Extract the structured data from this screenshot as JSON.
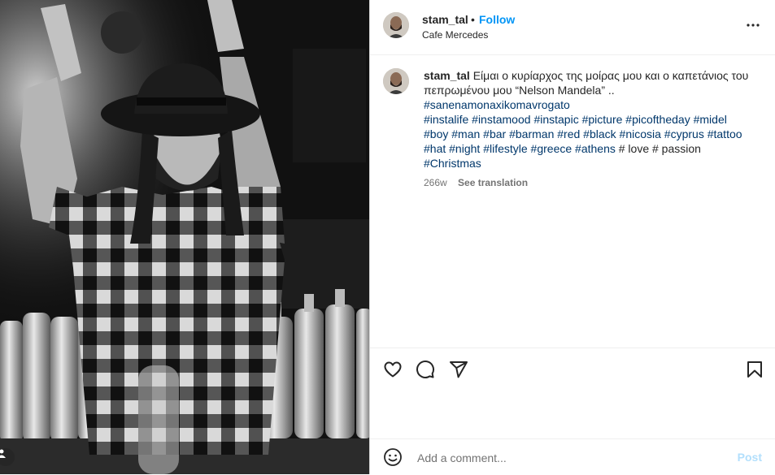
{
  "post": {
    "header": {
      "username": "stam_tal",
      "dot": "•",
      "follow_label": "Follow",
      "location": "Cafe Mercedes",
      "more_icon": "more-horizontal-icon"
    },
    "caption": {
      "username": "stam_tal",
      "text": "Είμαι ο κυρίαρχος της μοίρας μου και ο καπετάνιος του πεπρωμένου μου “Nelson Mandela” ..",
      "hashtags_line1": "#sanenamonaxikomavrogato",
      "hashtags_line2": [
        "#instalife",
        "#instamood",
        "#instapic",
        "#picture",
        "#picoftheday",
        "#midel"
      ],
      "hashtags_line3": [
        "#boy",
        "#man",
        "#bar",
        "#barman",
        "#red",
        "#black",
        "#nicosia",
        "#cyprus",
        "#tattoo"
      ],
      "hashtags_line4": [
        "#hat",
        "#night",
        "#lifestyle",
        "#greece",
        "#athens"
      ],
      "plain_tail": "# love # passion",
      "hashtag_last": "#Christmas",
      "time_ago": "266w",
      "see_translation": "See translation"
    },
    "actions": {
      "like_icon": "heart-icon",
      "comment_icon": "comment-icon",
      "share_icon": "send-icon",
      "save_icon": "bookmark-icon"
    },
    "comment": {
      "placeholder": "Add a comment...",
      "post_label": "Post",
      "emoji_icon": "smiley-icon"
    },
    "colors": {
      "link_blue": "#0095f6",
      "hashtag_blue": "#00376b",
      "post_disabled": "#b2dffc",
      "text": "#262626",
      "muted": "#737373"
    }
  }
}
